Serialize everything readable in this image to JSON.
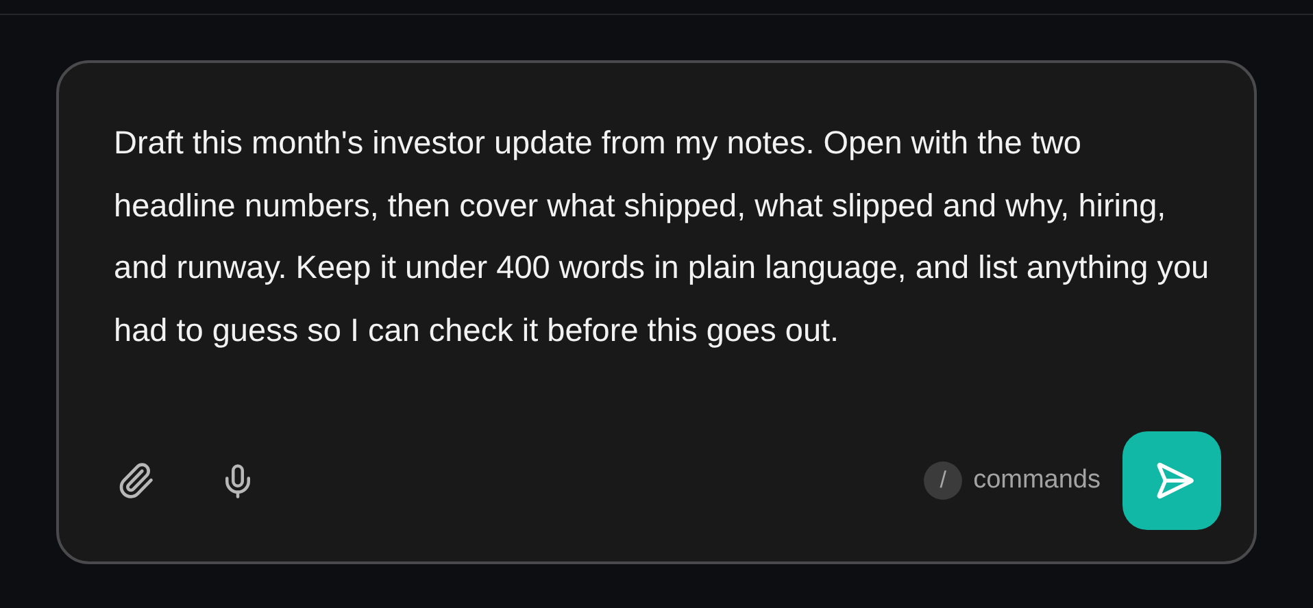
{
  "composer": {
    "message": "Draft this month's investor update from my notes. Open with the two headline numbers, then cover what shipped, what slipped and why, hiring, and runway. Keep it under 400 words in plain language, and list anything you had to guess so I can check it before this goes out.",
    "shortcut_key": "/",
    "shortcut_label": "commands"
  }
}
